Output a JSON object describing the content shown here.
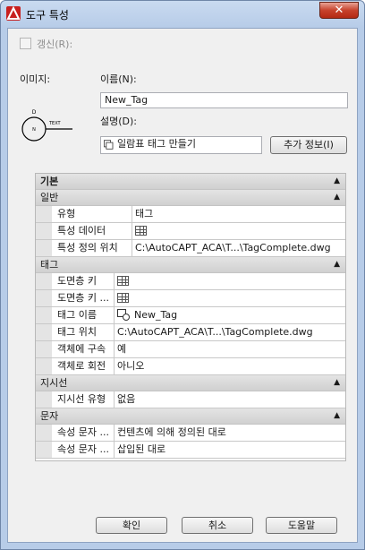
{
  "window": {
    "title": "도구 특성",
    "close_glyph": "✕"
  },
  "update_checkbox_label": "갱신(R):",
  "image_label": "이미지:",
  "name_label": "이름(N):",
  "name_value": "New_Tag",
  "description_label": "설명(D):",
  "description_value": "일람표 태그 만들기",
  "more_info_button": "추가 정보(I)",
  "preview_tag_letter": "D",
  "preview_tag_text": "TEXT",
  "preview_center_letter": "N",
  "property_grid": {
    "top_category": "기본",
    "groups": [
      {
        "name": "일반",
        "rows": [
          {
            "name": "유형",
            "value": "태그",
            "icon": ""
          },
          {
            "name": "특성 데이터",
            "value": "",
            "icon": "table-icon"
          },
          {
            "name": "특성 정의 위치",
            "value": "C:\\AutoCAPT_ACA\\T...\\TagComplete.dwg",
            "icon": ""
          }
        ]
      },
      {
        "name": "태그",
        "rows": [
          {
            "name": "도면층 키",
            "value": "",
            "icon": "table-icon"
          },
          {
            "name": "도면층 키 ...",
            "value": "",
            "icon": "table-icon"
          },
          {
            "name": "태그 이름",
            "value": "New_Tag",
            "icon": "tag-icon"
          },
          {
            "name": "태그 위치",
            "value": "C:\\AutoCAPT_ACA\\T...\\TagComplete.dwg",
            "icon": ""
          },
          {
            "name": "객체에 구속",
            "value": "예",
            "icon": ""
          },
          {
            "name": "객체로 회전",
            "value": "아니오",
            "icon": ""
          }
        ]
      },
      {
        "name": "지시선",
        "rows": [
          {
            "name": "지시선 유형",
            "value": "없음",
            "icon": ""
          }
        ]
      },
      {
        "name": "문자",
        "rows": [
          {
            "name": "속성 문자 ...",
            "value": "컨텐츠에 의해 정의된 대로",
            "icon": ""
          },
          {
            "name": "속성 문자 ...",
            "value": "삽입된 대로",
            "icon": ""
          }
        ]
      }
    ],
    "collapse_glyph": "▲"
  },
  "buttons": {
    "ok": "확인",
    "cancel": "취소",
    "help": "도움말"
  }
}
